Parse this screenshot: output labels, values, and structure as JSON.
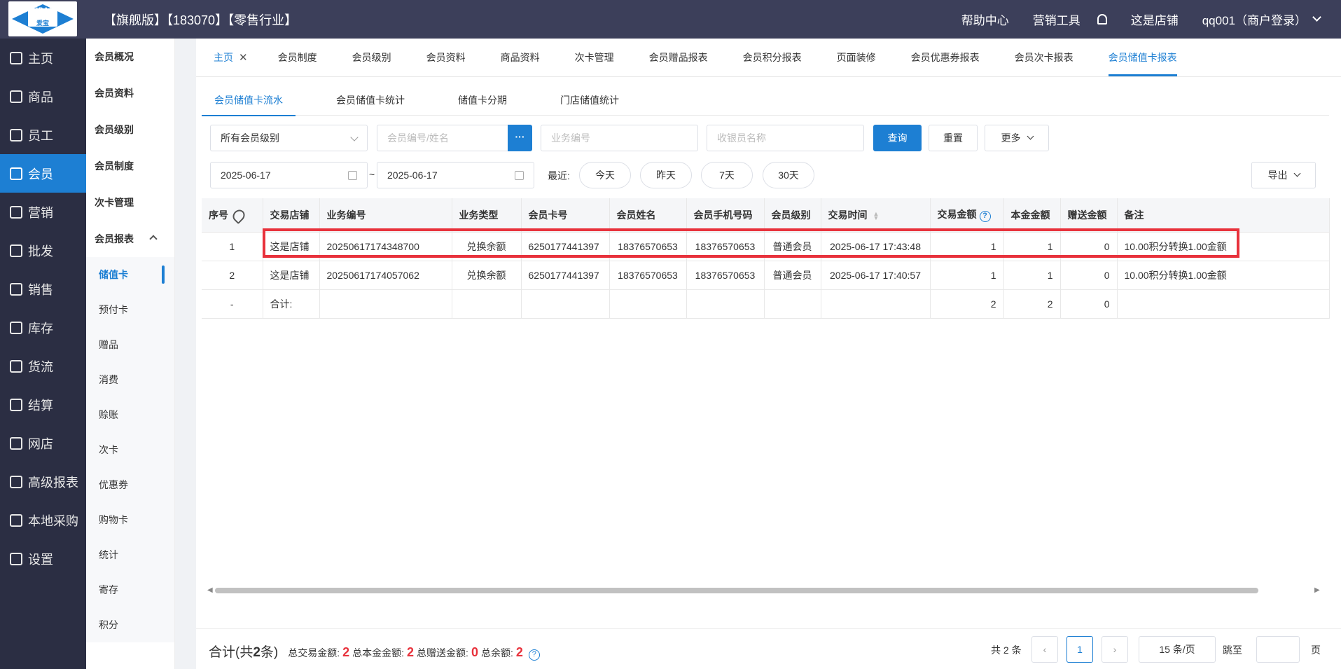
{
  "logo": {
    "top": "AIBAO",
    "bottom": "爱宝"
  },
  "header": {
    "store_title": "【旗舰版】【183070】【零售行业】",
    "help": "帮助中心",
    "marketing": "营销工具",
    "store": "这是店铺",
    "user": "qq001（商户登录）"
  },
  "sidebar": {
    "items": [
      {
        "label": "主页",
        "icon": "home-icon"
      },
      {
        "label": "商品",
        "icon": "box-icon"
      },
      {
        "label": "员工",
        "icon": "staff-icon"
      },
      {
        "label": "会员",
        "icon": "member-icon"
      },
      {
        "label": "营销",
        "icon": "megaphone-icon"
      },
      {
        "label": "批发",
        "icon": "wholesale-icon"
      },
      {
        "label": "销售",
        "icon": "chart-icon"
      },
      {
        "label": "库存",
        "icon": "pie-icon"
      },
      {
        "label": "货流",
        "icon": "cube-icon"
      },
      {
        "label": "结算",
        "icon": "settle-icon"
      },
      {
        "label": "网店",
        "icon": "gift-icon"
      },
      {
        "label": "高级报表",
        "icon": "line-chart-icon"
      },
      {
        "label": "本地采购",
        "icon": "trend-icon"
      },
      {
        "label": "设置",
        "icon": "gear-icon"
      }
    ]
  },
  "subnav": {
    "items": [
      "会员概况",
      "会员资料",
      "会员级别",
      "会员制度",
      "次卡管理",
      "会员报表"
    ],
    "children": [
      "储值卡",
      "预付卡",
      "赠品",
      "消费",
      "赊账",
      "次卡",
      "优惠券",
      "购物卡",
      "统计",
      "寄存",
      "积分"
    ]
  },
  "tabs1": [
    "主页",
    "会员制度",
    "会员级别",
    "会员资料",
    "商品资料",
    "次卡管理",
    "会员赠品报表",
    "会员积分报表",
    "页面装修",
    "会员优惠券报表",
    "会员次卡报表",
    "会员储值卡报表"
  ],
  "tabs2": [
    "会员储值卡流水",
    "会员储值卡统计",
    "储值卡分期",
    "门店储值统计"
  ],
  "filters": {
    "level": "所有会员级别",
    "member_ph": "会员编号/姓名",
    "dots": "···",
    "biz_ph": "业务编号",
    "cashier_ph": "收银员名称",
    "query": "查询",
    "reset": "重置",
    "more": "更多",
    "date_from": "2025-06-17",
    "tilde": "~",
    "date_to": "2025-06-17",
    "recent": "最近:",
    "today": "今天",
    "yesterday": "昨天",
    "d7": "7天",
    "d30": "30天",
    "export": "导出"
  },
  "table": {
    "headers": [
      "序号",
      "交易店铺",
      "业务编号",
      "业务类型",
      "会员卡号",
      "会员姓名",
      "会员手机号码",
      "会员级别",
      "交易时间",
      "交易金额",
      "本金金额",
      "赠送金额",
      "备注"
    ],
    "rows": [
      [
        "1",
        "这是店铺",
        "20250617174348700",
        "兑换余额",
        "6250177441397",
        "18376570653",
        "18376570653",
        "普通会员",
        "2025-06-17 17:43:48",
        "1",
        "1",
        "0",
        "10.00积分转换1.00金额"
      ],
      [
        "2",
        "这是店铺",
        "20250617174057062",
        "兑换余额",
        "6250177441397",
        "18376570653",
        "18376570653",
        "普通会员",
        "2025-06-17 17:40:57",
        "1",
        "1",
        "0",
        "10.00积分转换1.00金额"
      ]
    ],
    "total": [
      "-",
      "合计:",
      "",
      "",
      "",
      "",
      "",
      "",
      "",
      "2",
      "2",
      "0",
      ""
    ]
  },
  "footer": {
    "summary_prefix": "合计(共",
    "summary_count": "2",
    "summary_suffix": "条)",
    "total_trade_label": "总交易金额:",
    "total_trade": "2",
    "total_principal_label": "总本金金额:",
    "total_principal": "2",
    "total_gift_label": "总赠送金额:",
    "total_gift": "0",
    "total_balance_label": "总余额:",
    "total_balance": "2",
    "count_text": "共 2 条",
    "page": "1",
    "page_size": "15 条/页",
    "goto": "跳至",
    "page_unit": "页"
  },
  "colors": {
    "accent": "#1d7fd3",
    "highlight": "#e8323c",
    "topbar": "#3c3f5a",
    "sidebar": "#2b2e43"
  }
}
